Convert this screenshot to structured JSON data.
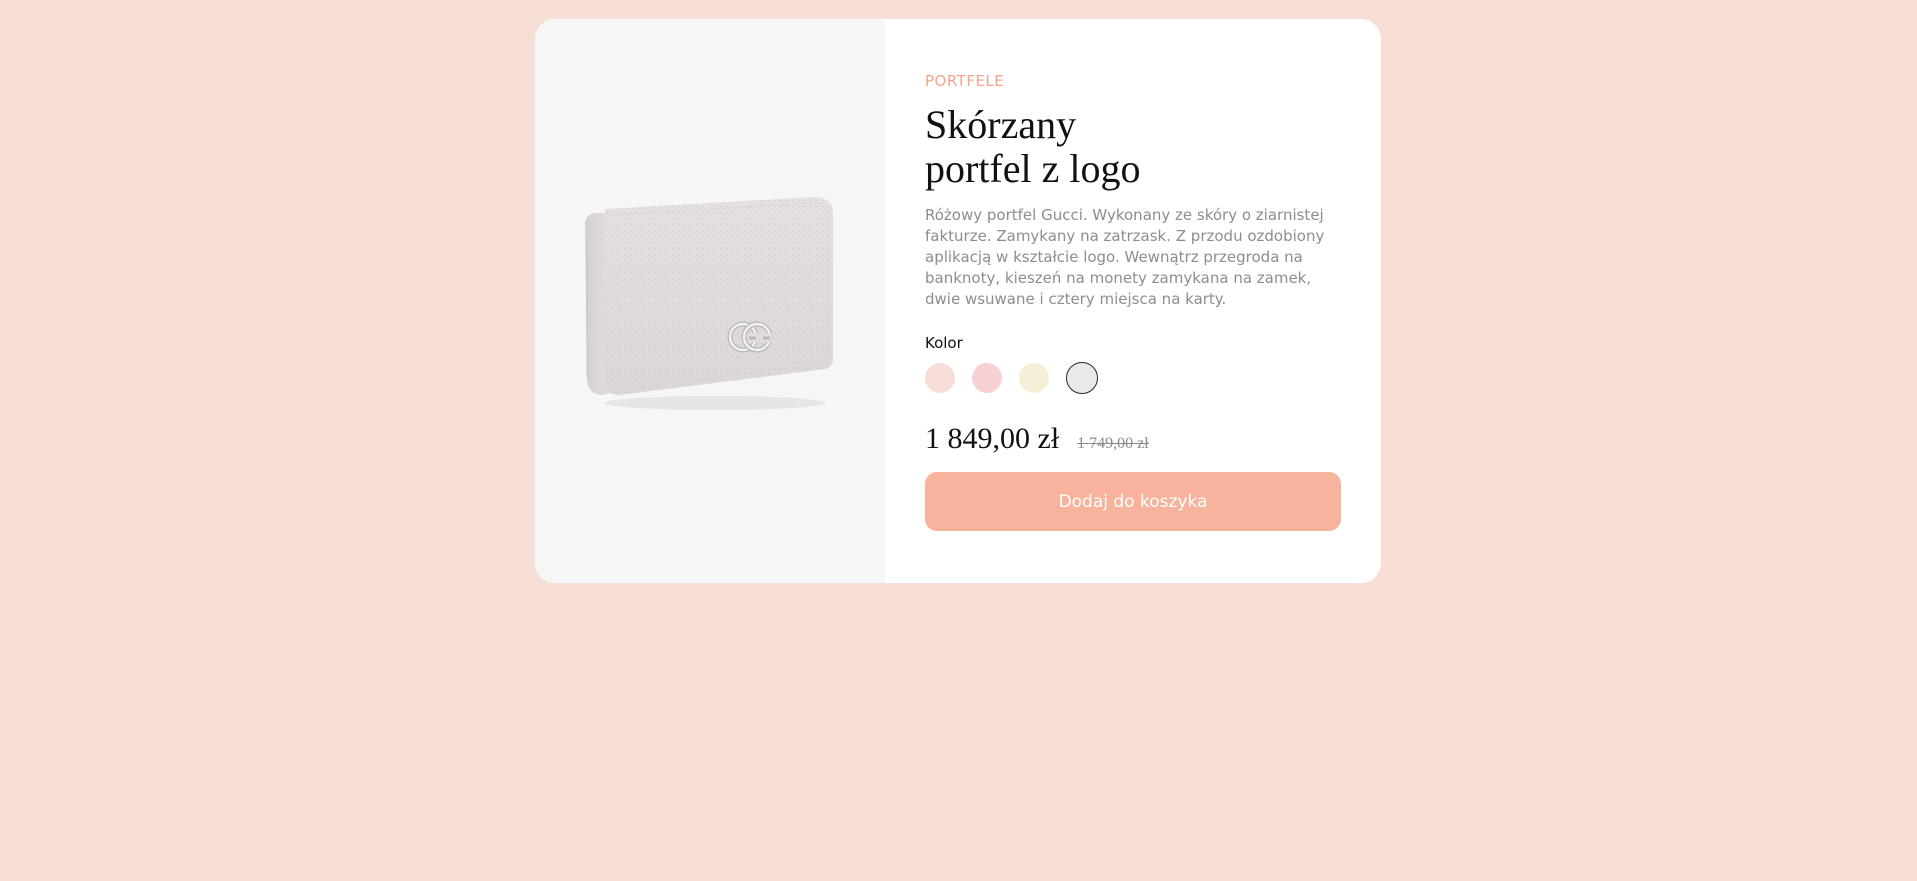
{
  "product": {
    "category": "PORTFELE",
    "title": "Skórzany portfel z logo",
    "description": "Różowy portfel Gucci. Wykonany ze skóry o ziarnistej fakturze. Zamykany na zatrzask. Z przodu ozdobiony aplikacją w kształcie logo. Wewnątrz przegroda na banknoty, kieszeń na monety zamykana na zamek, dwie wsuwane i cztery miejsca na karty.",
    "color_label": "Kolor",
    "colors": [
      "#f6ddd5",
      "#f6d2d4",
      "#f6efd7",
      "#e9e9e9"
    ],
    "selected_color_index": 3,
    "price": "1 849,00 zł",
    "old_price": "1 749,00 zł",
    "add_to_cart_label": "Dodaj do koszyka",
    "image_alt": "wallet-image"
  },
  "theme": {
    "page_bg": "#f8dfd6",
    "accent": "#f5a58c",
    "button_bg": "#f8b39c"
  }
}
